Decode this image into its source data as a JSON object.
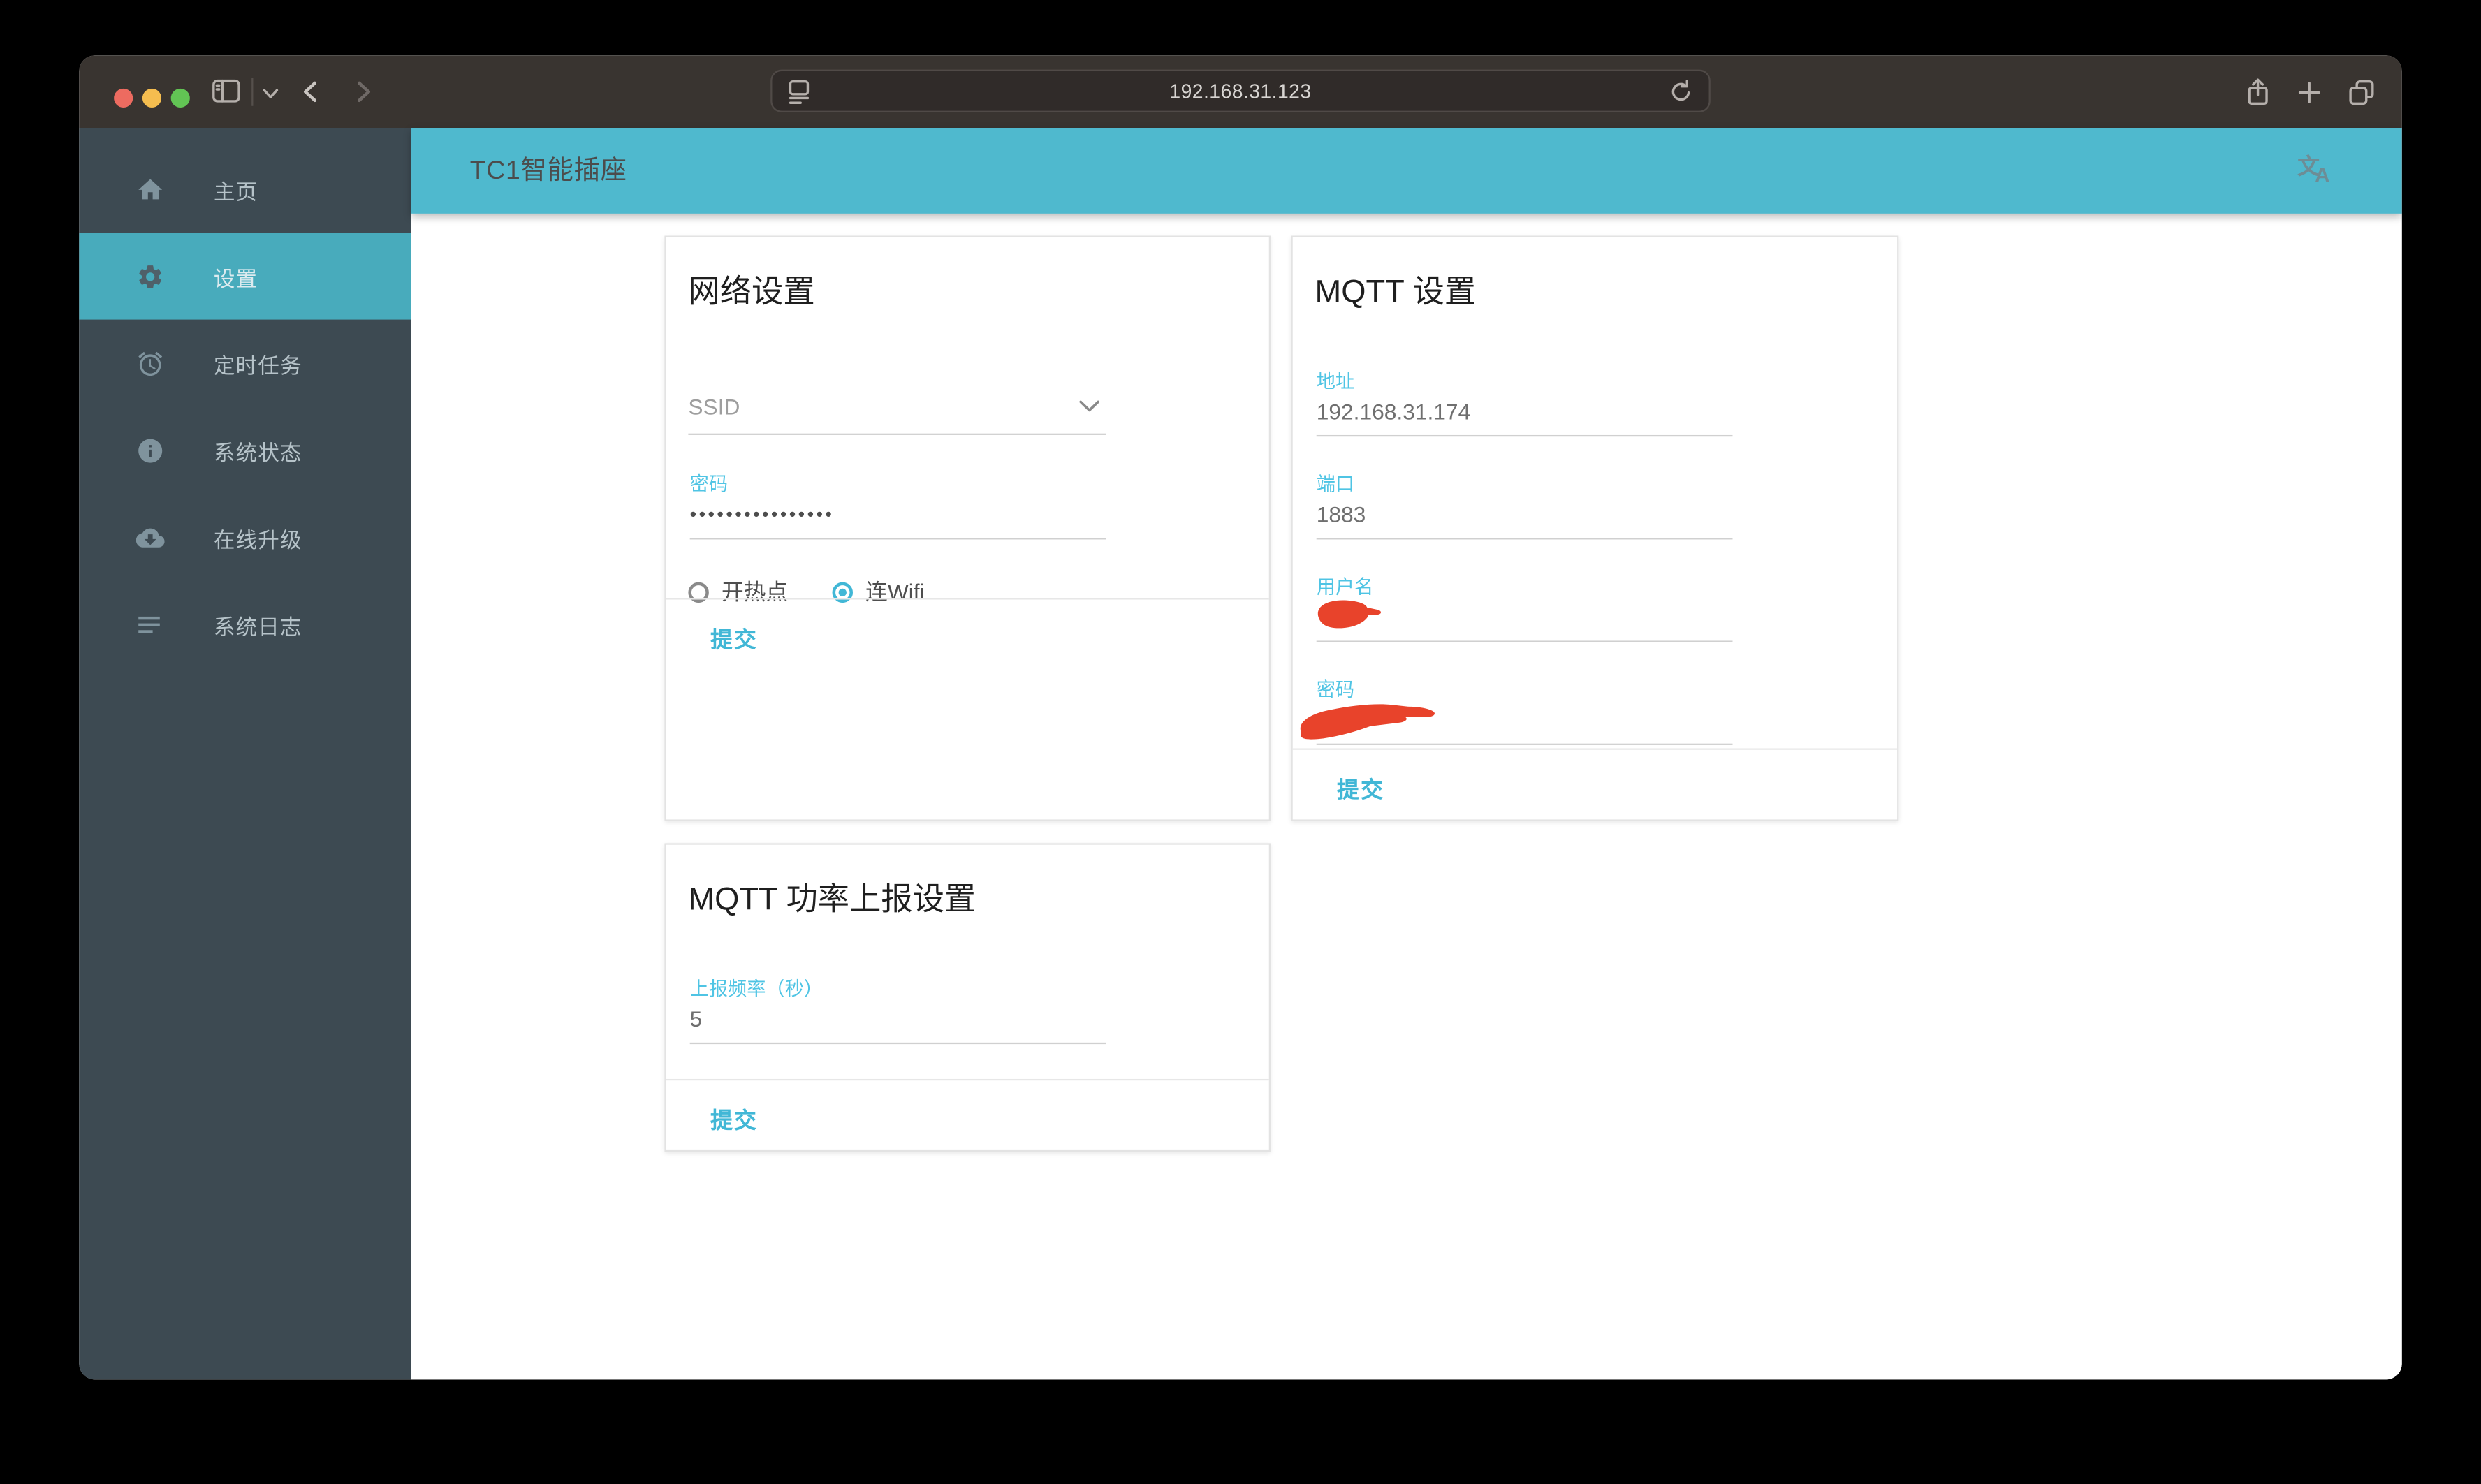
{
  "colors": {
    "header_teal": "#4fb9ce",
    "sidebar_active_teal": "#48abbc",
    "field_label_cyan": "#4fc4e4",
    "submit_teal": "#41b7d6",
    "redaction_red": "#e8432b"
  },
  "browser": {
    "url": "192.168.31.123"
  },
  "header": {
    "title": "TC1智能插座"
  },
  "sidebar": {
    "items": [
      {
        "label": "主页",
        "icon": "home-icon",
        "active": false
      },
      {
        "label": "设置",
        "icon": "gear-icon",
        "active": true
      },
      {
        "label": "定时任务",
        "icon": "alarm-icon",
        "active": false
      },
      {
        "label": "系统状态",
        "icon": "info-icon",
        "active": false
      },
      {
        "label": "在线升级",
        "icon": "cloud-download-icon",
        "active": false
      },
      {
        "label": "系统日志",
        "icon": "logs-icon",
        "active": false
      }
    ]
  },
  "cards": {
    "network": {
      "title": "网络设置",
      "ssid_placeholder": "SSID",
      "password_label": "密码",
      "password_value": "••••••••••••••••",
      "radios": [
        {
          "label": "开热点",
          "selected": false
        },
        {
          "label": "连Wifi",
          "selected": true
        }
      ],
      "submit_label": "提交"
    },
    "mqtt": {
      "title": "MQTT 设置",
      "address_label": "地址",
      "address_value": "192.168.31.174",
      "port_label": "端口",
      "port_value": "1883",
      "username_label": "用户名",
      "password_label": "密码",
      "submit_label": "提交"
    },
    "power": {
      "title": "MQTT 功率上报设置",
      "frequency_label": "上报频率（秒）",
      "frequency_value": "5",
      "submit_label": "提交"
    }
  }
}
